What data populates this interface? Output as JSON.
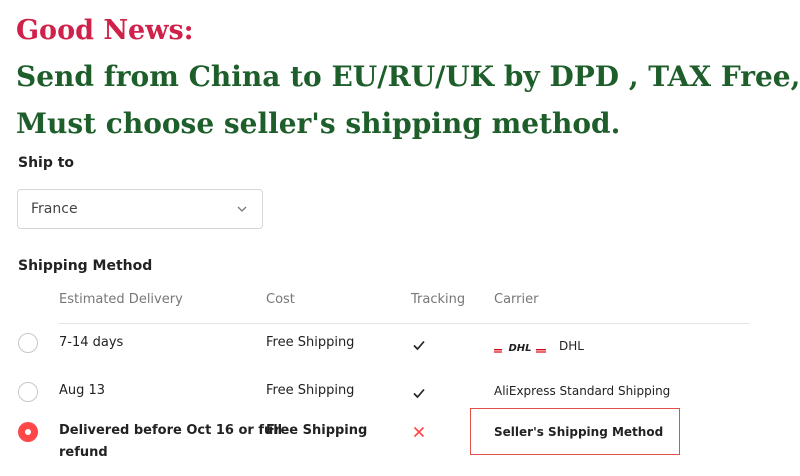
{
  "banner": {
    "line1": "Good News:",
    "line2": "Send from China to EU/RU/UK by DPD , TAX Free,",
    "line3": "Must choose seller's shipping method."
  },
  "ship_to": {
    "label": "Ship to",
    "selected": "France",
    "icon": "chevron-down-icon"
  },
  "shipping_method": {
    "label": "Shipping Method",
    "columns": [
      "Estimated Delivery",
      "Cost",
      "Tracking",
      "Carrier"
    ],
    "rows": [
      {
        "delivery": "7-14 days",
        "cost": "Free Shipping",
        "tracking_icon": "check-icon",
        "carrier": "DHL",
        "carrier_logo": "DHL",
        "selected": false
      },
      {
        "delivery": "Aug 13",
        "cost": "Free Shipping",
        "tracking_icon": "check-icon",
        "carrier": "AliExpress Standard Shipping",
        "selected": false
      },
      {
        "delivery_line1": "Delivered before Oct 16 or full",
        "delivery_line2": "refund",
        "cost": "Free Shipping",
        "tracking_icon": "cross-icon",
        "carrier": "Seller's Shipping Method",
        "selected": true
      }
    ]
  },
  "colors": {
    "good_news": "#d0214a",
    "headline": "#1d5e2b",
    "accent": "#ff4747",
    "dhl_red": "#d40511"
  }
}
